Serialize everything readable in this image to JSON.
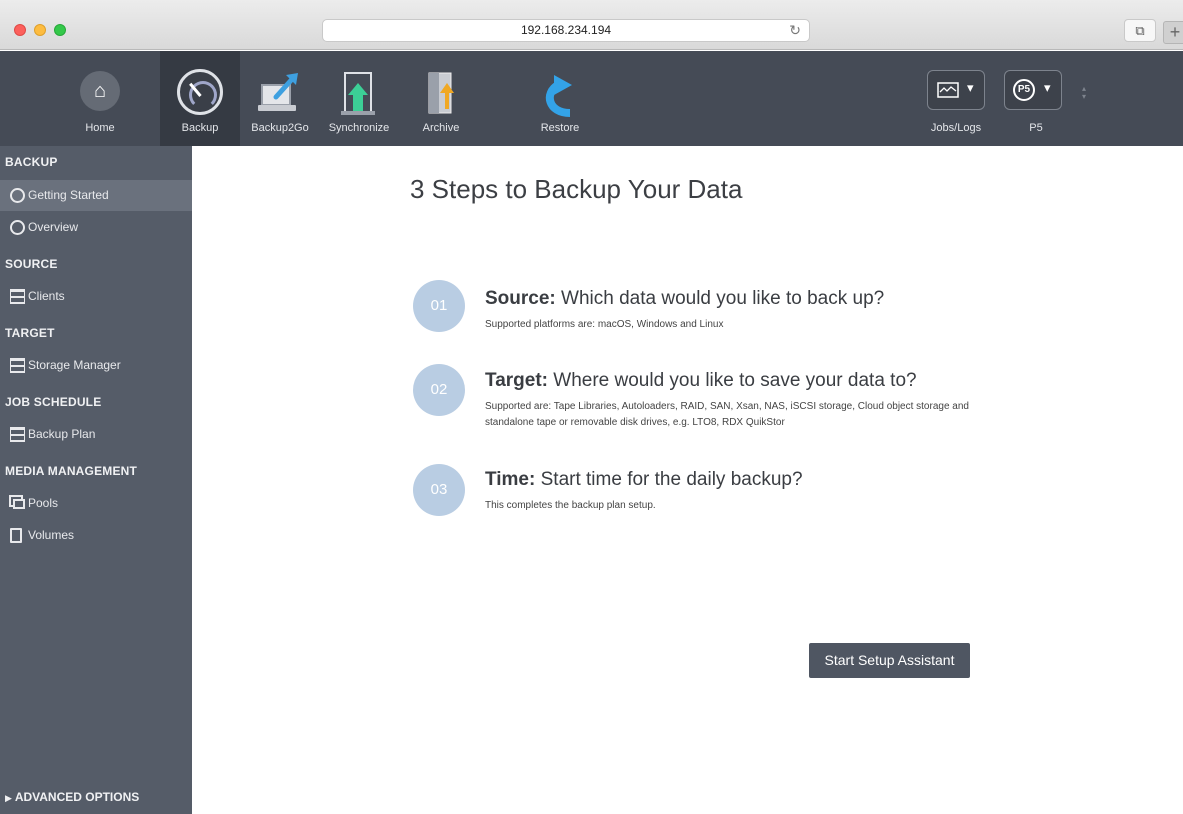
{
  "browser": {
    "url": "192.168.234.194",
    "reload_glyph": "↻",
    "tabs_glyph": "⧉",
    "new_tab_glyph": "+"
  },
  "toolbar": {
    "items": [
      {
        "label": "Home",
        "icon": "home-icon",
        "active": false
      },
      {
        "label": "Backup",
        "icon": "backup-gauge-icon",
        "active": true
      },
      {
        "label": "Backup2Go",
        "icon": "laptop-upload-icon",
        "active": false
      },
      {
        "label": "Synchronize",
        "icon": "synchronize-icon",
        "active": false
      },
      {
        "label": "Archive",
        "icon": "archive-icon",
        "active": false
      },
      {
        "label": "Restore",
        "icon": "restore-arrow-icon",
        "active": false
      }
    ],
    "jobs_logs_label": "Jobs/Logs",
    "p5_label": "P5",
    "p5_badge": "P5",
    "home_glyph": "⌂",
    "caret": "▾"
  },
  "sidebar": {
    "sections": [
      {
        "title": "BACKUP",
        "items": [
          {
            "label": "Getting Started",
            "icon": "getting-started-icon",
            "active": true
          },
          {
            "label": "Overview",
            "icon": "overview-icon",
            "active": false
          }
        ]
      },
      {
        "title": "SOURCE",
        "items": [
          {
            "label": "Clients",
            "icon": "clients-icon",
            "active": false
          }
        ]
      },
      {
        "title": "TARGET",
        "items": [
          {
            "label": "Storage Manager",
            "icon": "storage-manager-icon",
            "active": false
          }
        ]
      },
      {
        "title": "JOB SCHEDULE",
        "items": [
          {
            "label": "Backup Plan",
            "icon": "backup-plan-icon",
            "active": false
          }
        ]
      },
      {
        "title": "MEDIA MANAGEMENT",
        "items": [
          {
            "label": "Pools",
            "icon": "pools-icon",
            "active": false
          },
          {
            "label": "Volumes",
            "icon": "volumes-icon",
            "active": false
          }
        ]
      }
    ],
    "advanced_label": "ADVANCED OPTIONS",
    "advanced_arrow": "▶"
  },
  "main": {
    "title": "3 Steps to Backup Your Data",
    "steps": [
      {
        "number": "01",
        "heading": "Source:",
        "question": "Which data would you like to back up?",
        "description": "Supported platforms are: macOS, Windows and Linux"
      },
      {
        "number": "02",
        "heading": "Target:",
        "question": "Where would you like to save your data to?",
        "description": "Supported are: Tape Libraries, Autoloaders, RAID, SAN, Xsan, NAS, iSCSI storage, Cloud object storage and standalone tape or removable disk drives, e.g. LTO8, RDX QuikStor"
      },
      {
        "number": "03",
        "heading": "Time:",
        "question": "Start time for the daily backup?",
        "description": "This completes the backup plan setup."
      }
    ],
    "setup_button": "Start Setup Assistant"
  },
  "colors": {
    "toolbar_bg": "#454b56",
    "sidebar_bg": "#555c68",
    "step_circle": "#b9cde3",
    "button_bg": "#4f5662"
  }
}
